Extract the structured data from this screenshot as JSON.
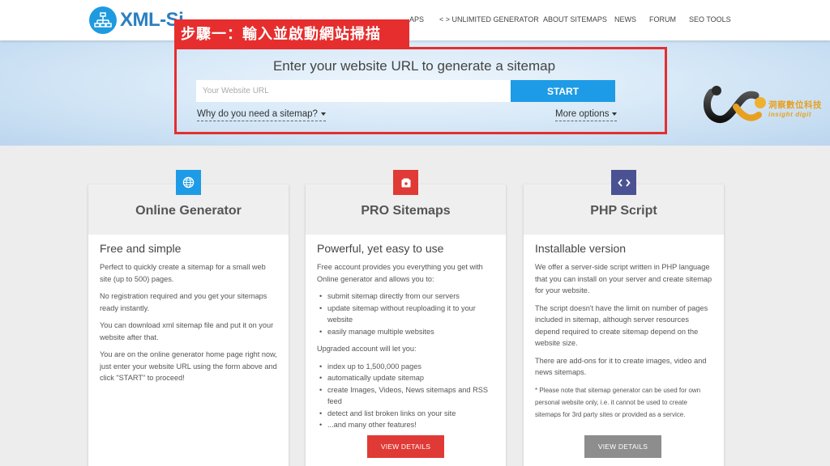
{
  "header": {
    "logo_text": "XML-Si",
    "nav": [
      {
        "label": "< > UNLIMITED GENERATOR"
      },
      {
        "label": "ABOUT SITEMAPS"
      },
      {
        "label": "NEWS"
      },
      {
        "label": "FORUM"
      },
      {
        "label": "SEO TOOLS"
      }
    ],
    "nav_partial": "APS"
  },
  "annotation": {
    "step_label": "步驟一：輸入並啟動網站掃描",
    "color": "#e62e2e"
  },
  "hero": {
    "title": "Enter your website URL to generate a sitemap",
    "url_placeholder": "Your Website URL",
    "start_label": "START",
    "why_link": "Why do you need a sitemap?",
    "more_options": "More options"
  },
  "watermark": {
    "name": "洞察數位科技",
    "sub": "insight digit"
  },
  "cards": [
    {
      "title": "Online Generator",
      "icon": "globe-icon",
      "icon_color": "#1d9be6",
      "subtitle": "Free and simple",
      "paragraphs": [
        "Perfect to quickly create a sitemap for a small web site (up to 500) pages.",
        "No registration required and you get your sitemaps ready instantly.",
        "You can download xml sitemap file and put it on your website after that.",
        "You are on the online generator home page right now, just enter your website URL using the form above and click \"START\" to proceed!"
      ]
    },
    {
      "title": "PRO Sitemaps",
      "icon": "box-icon",
      "icon_color": "#e03a36",
      "subtitle": "Powerful, yet easy to use",
      "intro": "Free account provides you everything you get with Online generator and allows you to:",
      "list1": [
        "submit sitemap directly from our servers",
        "update sitemap without reuploading it to your website",
        "easily manage multiple websites"
      ],
      "mid": "Upgraded account will let you:",
      "list2": [
        "index up to 1,500,000 pages",
        "automatically update sitemap",
        "create Images, Videos, News sitemaps and RSS feed",
        "detect and list broken links on your site",
        "...and many other features!"
      ],
      "button": "VIEW DETAILS",
      "button_color": "#e03a36"
    },
    {
      "title": "PHP Script",
      "icon": "code-icon",
      "icon_color": "#4b5293",
      "subtitle": "Installable version",
      "paragraphs": [
        "We offer a server-side script written in PHP language that you can install on your server and create sitemap for your website.",
        "The script doesn't have the limit on number of pages included in sitemap, although server resources depend required to create sitemap depend on the website size.",
        "There are add-ons for it to create images, video and news sitemaps."
      ],
      "note": "* Please note that sitemap generator can be used for own personal website only, i.e. it cannot be used to create sitemaps for 3rd party sites or provided as a service.",
      "button": "VIEW DETAILS",
      "button_color": "#8d8d8d"
    }
  ]
}
